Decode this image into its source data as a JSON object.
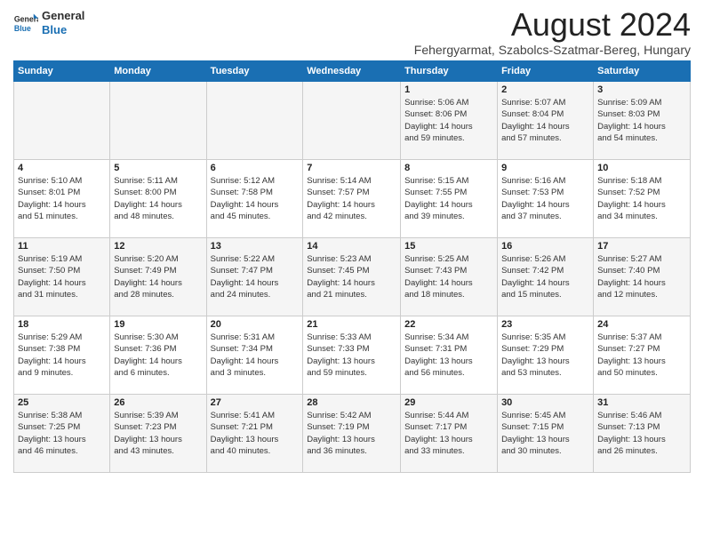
{
  "header": {
    "logo_line1": "General",
    "logo_line2": "Blue",
    "month": "August 2024",
    "location": "Fehergyarmat, Szabolcs-Szatmar-Bereg, Hungary"
  },
  "weekdays": [
    "Sunday",
    "Monday",
    "Tuesday",
    "Wednesday",
    "Thursday",
    "Friday",
    "Saturday"
  ],
  "weeks": [
    [
      {
        "day": "",
        "info": ""
      },
      {
        "day": "",
        "info": ""
      },
      {
        "day": "",
        "info": ""
      },
      {
        "day": "",
        "info": ""
      },
      {
        "day": "1",
        "info": "Sunrise: 5:06 AM\nSunset: 8:06 PM\nDaylight: 14 hours\nand 59 minutes."
      },
      {
        "day": "2",
        "info": "Sunrise: 5:07 AM\nSunset: 8:04 PM\nDaylight: 14 hours\nand 57 minutes."
      },
      {
        "day": "3",
        "info": "Sunrise: 5:09 AM\nSunset: 8:03 PM\nDaylight: 14 hours\nand 54 minutes."
      }
    ],
    [
      {
        "day": "4",
        "info": "Sunrise: 5:10 AM\nSunset: 8:01 PM\nDaylight: 14 hours\nand 51 minutes."
      },
      {
        "day": "5",
        "info": "Sunrise: 5:11 AM\nSunset: 8:00 PM\nDaylight: 14 hours\nand 48 minutes."
      },
      {
        "day": "6",
        "info": "Sunrise: 5:12 AM\nSunset: 7:58 PM\nDaylight: 14 hours\nand 45 minutes."
      },
      {
        "day": "7",
        "info": "Sunrise: 5:14 AM\nSunset: 7:57 PM\nDaylight: 14 hours\nand 42 minutes."
      },
      {
        "day": "8",
        "info": "Sunrise: 5:15 AM\nSunset: 7:55 PM\nDaylight: 14 hours\nand 39 minutes."
      },
      {
        "day": "9",
        "info": "Sunrise: 5:16 AM\nSunset: 7:53 PM\nDaylight: 14 hours\nand 37 minutes."
      },
      {
        "day": "10",
        "info": "Sunrise: 5:18 AM\nSunset: 7:52 PM\nDaylight: 14 hours\nand 34 minutes."
      }
    ],
    [
      {
        "day": "11",
        "info": "Sunrise: 5:19 AM\nSunset: 7:50 PM\nDaylight: 14 hours\nand 31 minutes."
      },
      {
        "day": "12",
        "info": "Sunrise: 5:20 AM\nSunset: 7:49 PM\nDaylight: 14 hours\nand 28 minutes."
      },
      {
        "day": "13",
        "info": "Sunrise: 5:22 AM\nSunset: 7:47 PM\nDaylight: 14 hours\nand 24 minutes."
      },
      {
        "day": "14",
        "info": "Sunrise: 5:23 AM\nSunset: 7:45 PM\nDaylight: 14 hours\nand 21 minutes."
      },
      {
        "day": "15",
        "info": "Sunrise: 5:25 AM\nSunset: 7:43 PM\nDaylight: 14 hours\nand 18 minutes."
      },
      {
        "day": "16",
        "info": "Sunrise: 5:26 AM\nSunset: 7:42 PM\nDaylight: 14 hours\nand 15 minutes."
      },
      {
        "day": "17",
        "info": "Sunrise: 5:27 AM\nSunset: 7:40 PM\nDaylight: 14 hours\nand 12 minutes."
      }
    ],
    [
      {
        "day": "18",
        "info": "Sunrise: 5:29 AM\nSunset: 7:38 PM\nDaylight: 14 hours\nand 9 minutes."
      },
      {
        "day": "19",
        "info": "Sunrise: 5:30 AM\nSunset: 7:36 PM\nDaylight: 14 hours\nand 6 minutes."
      },
      {
        "day": "20",
        "info": "Sunrise: 5:31 AM\nSunset: 7:34 PM\nDaylight: 14 hours\nand 3 minutes."
      },
      {
        "day": "21",
        "info": "Sunrise: 5:33 AM\nSunset: 7:33 PM\nDaylight: 13 hours\nand 59 minutes."
      },
      {
        "day": "22",
        "info": "Sunrise: 5:34 AM\nSunset: 7:31 PM\nDaylight: 13 hours\nand 56 minutes."
      },
      {
        "day": "23",
        "info": "Sunrise: 5:35 AM\nSunset: 7:29 PM\nDaylight: 13 hours\nand 53 minutes."
      },
      {
        "day": "24",
        "info": "Sunrise: 5:37 AM\nSunset: 7:27 PM\nDaylight: 13 hours\nand 50 minutes."
      }
    ],
    [
      {
        "day": "25",
        "info": "Sunrise: 5:38 AM\nSunset: 7:25 PM\nDaylight: 13 hours\nand 46 minutes."
      },
      {
        "day": "26",
        "info": "Sunrise: 5:39 AM\nSunset: 7:23 PM\nDaylight: 13 hours\nand 43 minutes."
      },
      {
        "day": "27",
        "info": "Sunrise: 5:41 AM\nSunset: 7:21 PM\nDaylight: 13 hours\nand 40 minutes."
      },
      {
        "day": "28",
        "info": "Sunrise: 5:42 AM\nSunset: 7:19 PM\nDaylight: 13 hours\nand 36 minutes."
      },
      {
        "day": "29",
        "info": "Sunrise: 5:44 AM\nSunset: 7:17 PM\nDaylight: 13 hours\nand 33 minutes."
      },
      {
        "day": "30",
        "info": "Sunrise: 5:45 AM\nSunset: 7:15 PM\nDaylight: 13 hours\nand 30 minutes."
      },
      {
        "day": "31",
        "info": "Sunrise: 5:46 AM\nSunset: 7:13 PM\nDaylight: 13 hours\nand 26 minutes."
      }
    ]
  ]
}
